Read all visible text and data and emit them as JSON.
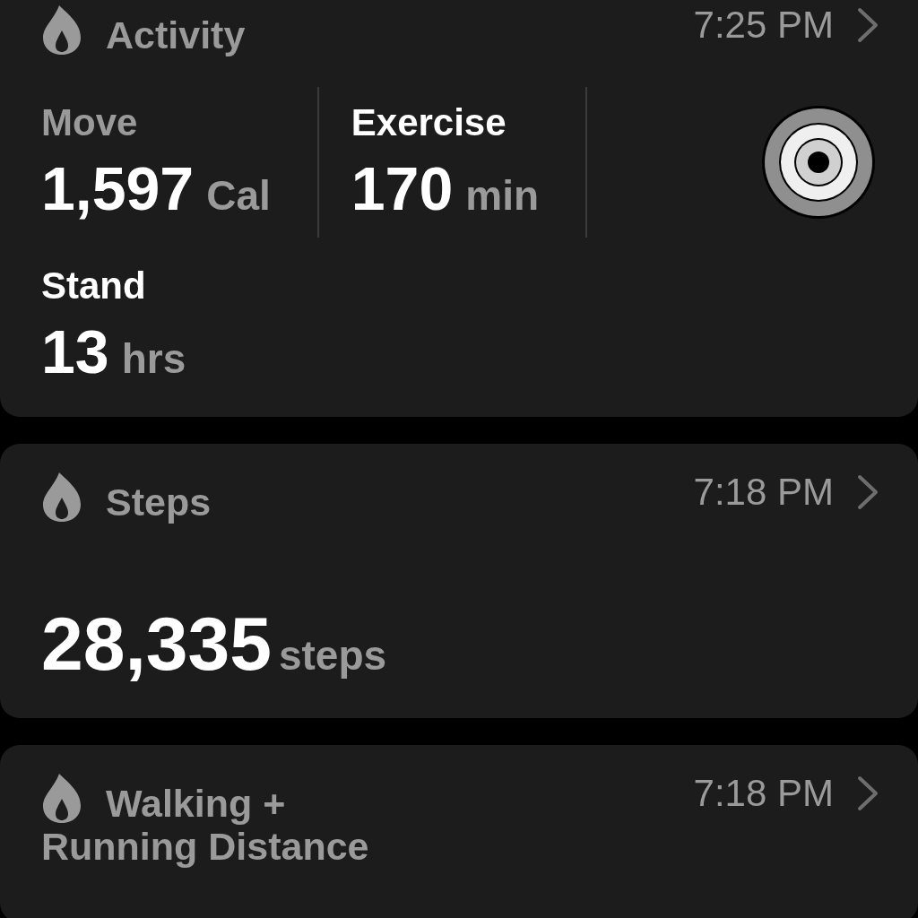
{
  "cards": [
    {
      "title": "Activity",
      "time": "7:25 PM",
      "kind": "activity",
      "metrics": [
        {
          "label": "Move",
          "value": "1,597",
          "unit": "Cal",
          "muted": true
        },
        {
          "label": "Exercise",
          "value": "170",
          "unit": "min",
          "muted": false
        },
        {
          "label": "Stand",
          "value": "13",
          "unit": "hrs",
          "muted": false
        }
      ]
    },
    {
      "title": "Steps",
      "time": "7:18 PM",
      "kind": "value",
      "value": "28,335",
      "unit": "steps"
    },
    {
      "title": "Walking +",
      "title_continued": "Running Distance",
      "time": "7:18 PM",
      "kind": "title_only"
    }
  ]
}
